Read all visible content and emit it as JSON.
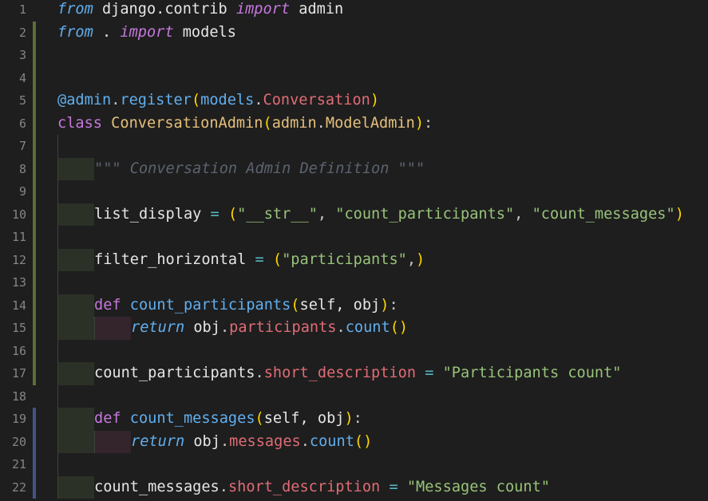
{
  "editor": {
    "line_numbers": [
      "1",
      "2",
      "3",
      "4",
      "5",
      "6",
      "7",
      "8",
      "9",
      "10",
      "11",
      "12",
      "13",
      "14",
      "15",
      "16",
      "17",
      "18",
      "19",
      "20",
      "21",
      "22"
    ],
    "l1": {
      "from": "from",
      "module": " django.contrib ",
      "import": "import",
      "name": " admin"
    },
    "l2": {
      "from": "from",
      "module": " . ",
      "import": "import",
      "name": " models"
    },
    "l5": {
      "at": "@",
      "admin": "admin",
      "dot1": ".",
      "register": "register",
      "p1": "(",
      "models": "models",
      "dot2": ".",
      "conv": "Conversation",
      "p2": ")"
    },
    "l6": {
      "class": "class",
      "name": " ConversationAdmin",
      "p1": "(",
      "admin": "admin",
      "dot": ".",
      "base": "ModelAdmin",
      "p2": ")",
      "colon": ":"
    },
    "l8": {
      "doc": "\"\"\" Conversation Admin Definition \"\"\""
    },
    "l10": {
      "var": "list_display",
      "eq": " = ",
      "p1": "(",
      "s1": "\"__str__\"",
      "c1": ", ",
      "s2": "\"count_participants\"",
      "c2": ", ",
      "s3": "\"count_messages\"",
      "p2": ")"
    },
    "l12": {
      "var": "filter_horizontal",
      "eq": " = ",
      "p1": "(",
      "s1": "\"participants\"",
      "c1": ",",
      "p2": ")"
    },
    "l14": {
      "def": "def",
      "name": " count_participants",
      "p1": "(",
      "params": "self, obj",
      "p2": ")",
      "colon": ":"
    },
    "l15": {
      "ret": "return",
      "obj": " obj",
      "dot1": ".",
      "attr": "participants",
      "dot2": ".",
      "fn": "count",
      "p": "()"
    },
    "l17": {
      "var": "count_participants",
      "dot": ".",
      "attr": "short_description",
      "eq": " = ",
      "str": "\"Participants count\""
    },
    "l19": {
      "def": "def",
      "name": " count_messages",
      "p1": "(",
      "params": "self, obj",
      "p2": ")",
      "colon": ":"
    },
    "l20": {
      "ret": "return",
      "obj": " obj",
      "dot1": ".",
      "attr": "messages",
      "dot2": ".",
      "fn": "count",
      "p": "()"
    },
    "l22": {
      "var": "count_messages",
      "dot": ".",
      "attr": "short_description",
      "eq": " = ",
      "str": "\"Messages count\""
    }
  }
}
